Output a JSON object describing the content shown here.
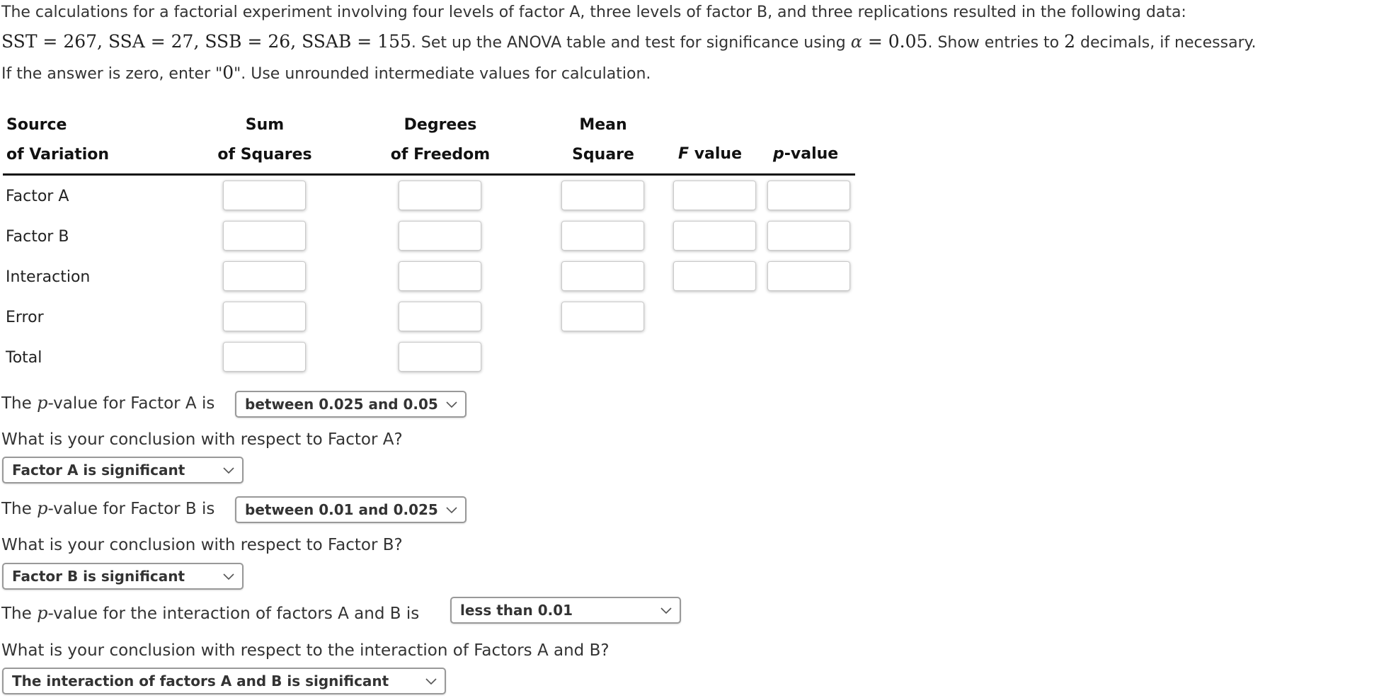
{
  "intro": {
    "line1": "The calculations for a factorial experiment involving four levels of factor A, three levels of factor B, and three replications resulted in the following data:",
    "line2_math": "SST = 267, SSA = 27, SSB = 26, SSAB = 155",
    "line2_text_a": ". Set up the ANOVA table and test for significance using ",
    "alpha_symbol": "α",
    "alpha_math": " = 0.05",
    "line2_text_b": ". Show entries to ",
    "decimals": "2",
    "line2_text_c": " decimals, if necessary.",
    "line3_a": "If the answer is zero, enter \"",
    "zero": "0",
    "line3_b": "\". Use unrounded intermediate values for calculation."
  },
  "table": {
    "headers": {
      "source": [
        "Source",
        "of Variation"
      ],
      "ss": [
        "Sum",
        "of Squares"
      ],
      "df": [
        "Degrees",
        "of Freedom"
      ],
      "ms": [
        "Mean",
        "Square"
      ],
      "f_italic": "F",
      "f_rest": " value",
      "p_italic": "p",
      "p_rest": "-value"
    },
    "rows": [
      {
        "label": "Factor A",
        "ss": "",
        "df": "",
        "ms": "",
        "f": "",
        "p": ""
      },
      {
        "label": "Factor B",
        "ss": "",
        "df": "",
        "ms": "",
        "f": "",
        "p": ""
      },
      {
        "label": "Interaction",
        "ss": "",
        "df": "",
        "ms": "",
        "f": "",
        "p": ""
      },
      {
        "label": "Error",
        "ss": "",
        "df": "",
        "ms": ""
      },
      {
        "label": "Total",
        "ss": "",
        "df": ""
      }
    ]
  },
  "questions": {
    "pA_prefix": "The ",
    "p_symbol": "p",
    "pA_suffix": "-value for Factor A is",
    "pA_value": "between 0.025 and 0.05",
    "concA_question": "What is your conclusion with respect to Factor A?",
    "concA_value": "Factor A is significant",
    "pB_suffix": "-value for Factor B is",
    "pB_value": "between 0.01 and 0.025",
    "concB_question": "What is your conclusion with respect to Factor B?",
    "concB_value": "Factor B is significant",
    "pAB_suffix": "-value for the interaction of factors A and B is",
    "pAB_value": "less than 0.01",
    "concAB_question": "What is your conclusion with respect to the interaction of Factors A and B?",
    "concAB_value": "The interaction of factors A and B is significant"
  },
  "icons": {
    "dropdown": "chevron-down-icon"
  }
}
